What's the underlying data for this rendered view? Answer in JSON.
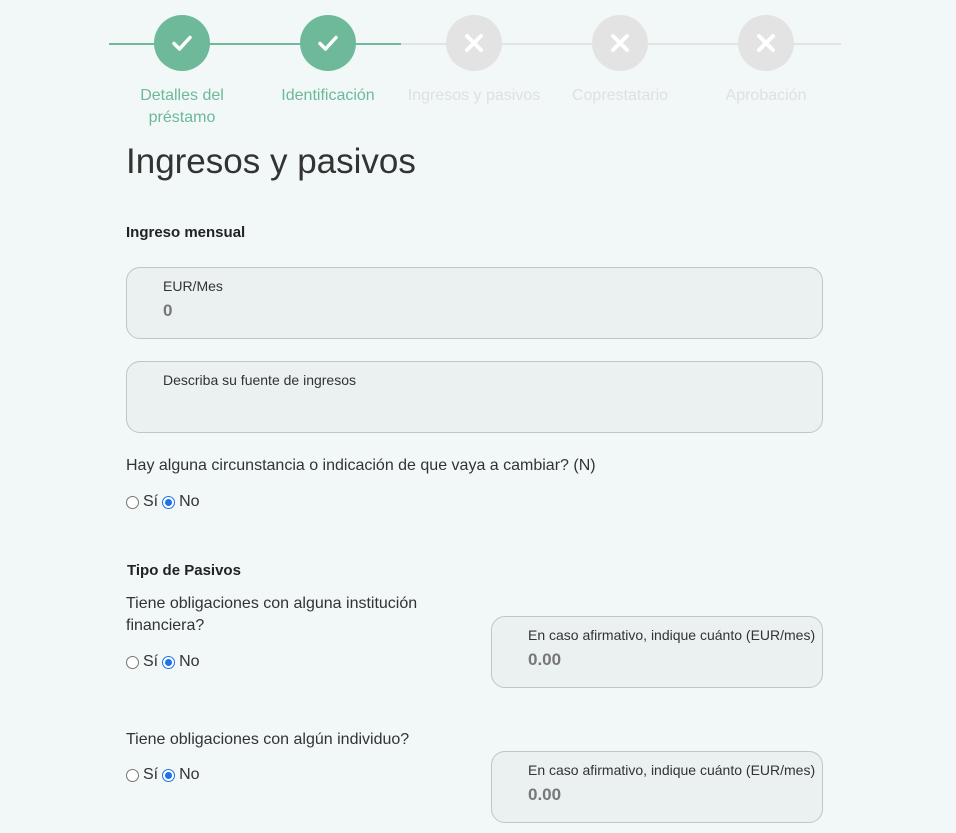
{
  "stepper": {
    "steps": [
      {
        "label": "Detalles del préstamo",
        "status": "done",
        "icon": "check-icon"
      },
      {
        "label": "Identificación",
        "status": "done",
        "icon": "check-icon"
      },
      {
        "label": "Ingresos y pasivos",
        "status": "pending",
        "icon": "x-icon"
      },
      {
        "label": "Coprestatario",
        "status": "pending",
        "icon": "x-icon"
      },
      {
        "label": "Aprobación",
        "status": "pending",
        "icon": "x-icon"
      }
    ],
    "done_color": "#6db99a",
    "pending_color": "#e3e3e3"
  },
  "page_title": "Ingresos y pasivos",
  "income": {
    "section_title": "Ingreso mensual",
    "amount_label": "EUR/Mes",
    "amount_value": "0",
    "source_label": "Describa su fuente de ingresos",
    "source_value": "",
    "change_question": "Hay alguna circunstancia o indicación de que vaya a cambiar? (N)",
    "change_yes": "Sí",
    "change_no": "No",
    "change_selected": "No"
  },
  "liabilities": {
    "section_title": "Tipo de Pasivos",
    "financial_question": "Tiene obligaciones con alguna institución financiera?",
    "financial_yes": "Sí",
    "financial_no": "No",
    "financial_selected": "No",
    "financial_amount_label": "En caso afirmativo, indique cuánto (EUR/mes)",
    "financial_amount_value": "0.00",
    "individual_question": "Tiene obligaciones con algún individuo?",
    "individual_yes": "Sí",
    "individual_no": "No",
    "individual_selected": "No",
    "individual_amount_label": "En caso afirmativo, indique cuánto (EUR/mes)",
    "individual_amount_value": "0.00"
  }
}
